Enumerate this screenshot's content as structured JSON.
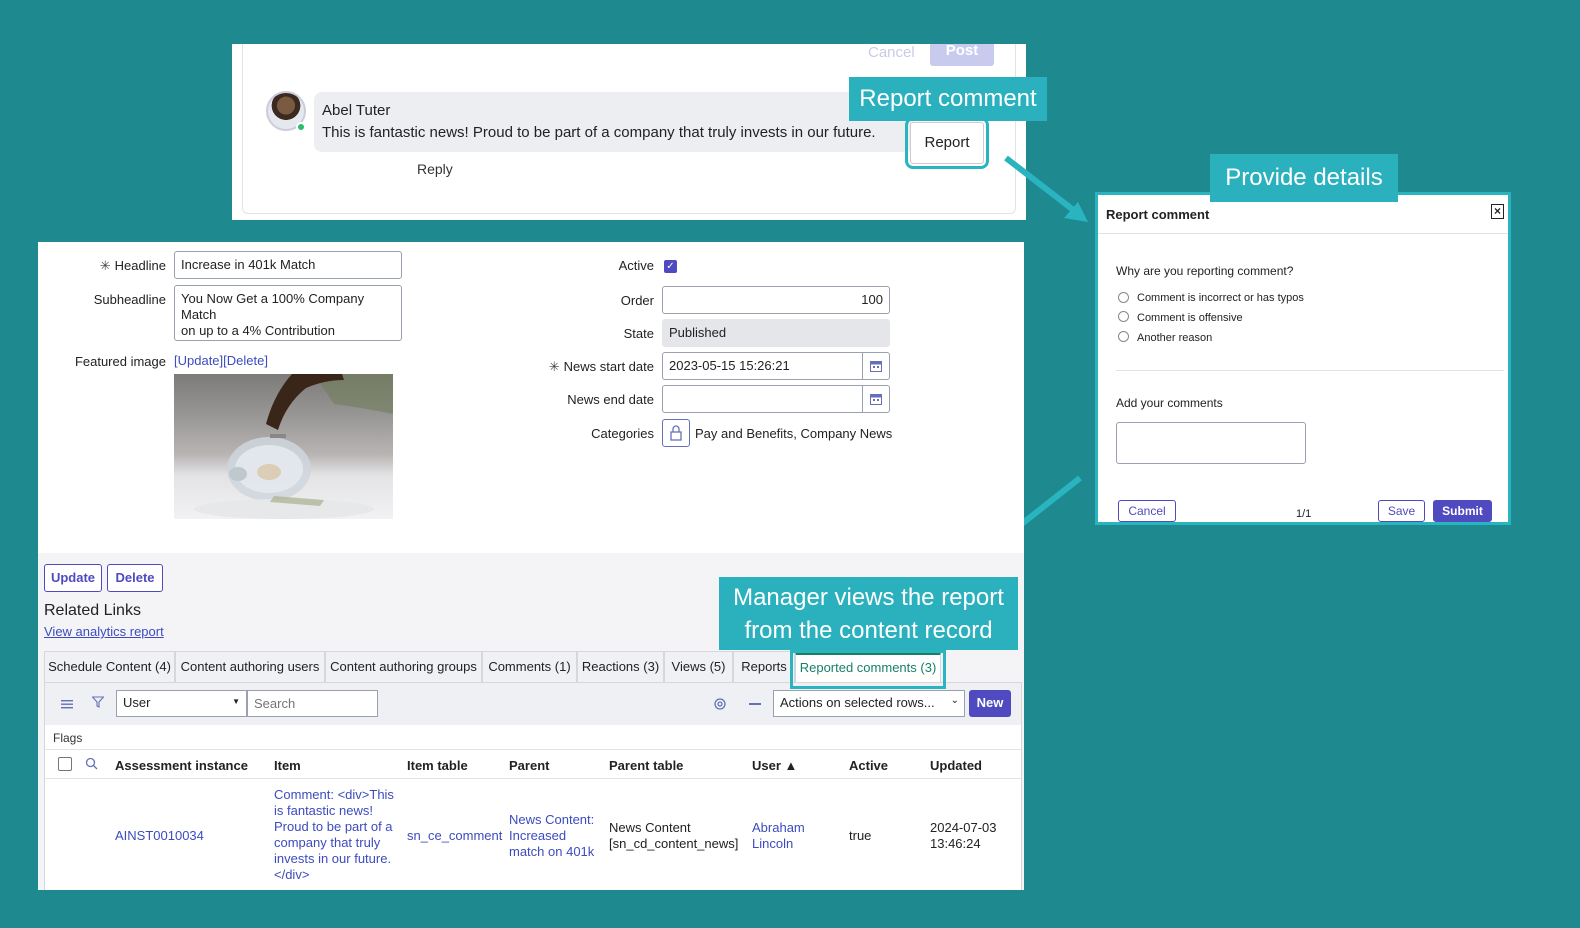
{
  "comment_panel": {
    "cancel_label": "Cancel",
    "post_label": "Post",
    "author": "Abel Tuter",
    "text": "This is fantastic news! Proud to be part of a company that truly invests in our future.",
    "reply_label": "Reply",
    "report_label": "Report"
  },
  "callouts": {
    "report_comment": "Report comment",
    "provide_details": "Provide details",
    "manager_line1": "Manager views the report",
    "manager_line2": "from the content record"
  },
  "form": {
    "headline_label": "Headline",
    "headline_value": "Increase in 401k Match",
    "subheadline_label": "Subheadline",
    "subheadline_line1": "You Now Get a 100% Company Match",
    "subheadline_line2": "on up to a 4% Contribution",
    "featured_image_label": "Featured image",
    "update_link": "[Update]",
    "delete_link": "[Delete]",
    "active_label": "Active",
    "order_label": "Order",
    "order_value": "100",
    "state_label": "State",
    "state_value": "Published",
    "news_start_label": "News start date",
    "news_start_value": "2023-05-15 15:26:21",
    "news_end_label": "News end date",
    "news_end_value": "",
    "categories_label": "Categories",
    "categories_value": "Pay and Benefits, Company News",
    "update_button": "Update",
    "delete_button": "Delete",
    "related_links": "Related Links",
    "analytics_link": "View analytics report"
  },
  "tabs": [
    {
      "label": "Schedule Content (4)"
    },
    {
      "label": "Content authoring users"
    },
    {
      "label": "Content authoring groups"
    },
    {
      "label": "Comments (1)"
    },
    {
      "label": "Reactions (3)"
    },
    {
      "label": "Views (5)"
    },
    {
      "label": "Reports"
    },
    {
      "label": "Reported comments (3)"
    }
  ],
  "list": {
    "filter_field": "User",
    "search_placeholder": "Search",
    "actions_label": "Actions on selected rows...",
    "new_label": "New",
    "flags_label": "Flags",
    "columns": [
      "Assessment instance",
      "Item",
      "Item table",
      "Parent",
      "Parent table",
      "User ▲",
      "Active",
      "Updated"
    ],
    "row": {
      "assessment": "AINST0010034",
      "item_lines": [
        "Comment: <div>This",
        "is fantastic news!",
        "Proud to be part of a",
        "company that truly",
        "invests in our future.",
        "</div>"
      ],
      "item_table": "sn_ce_comment",
      "parent_lines": [
        "News Content:",
        "Increased",
        "match on 401k"
      ],
      "parent_table_lines": [
        "News Content",
        "[sn_cd_content_news]"
      ],
      "user_lines": [
        "Abraham",
        "Lincoln"
      ],
      "active": "true",
      "updated_lines": [
        "2024-07-03",
        "13:46:24"
      ]
    }
  },
  "dialog": {
    "title": "Report comment",
    "close_label": "×",
    "question": "Why are you reporting comment?",
    "options": [
      "Comment is incorrect or has typos",
      "Comment is offensive",
      "Another reason"
    ],
    "comments_label": "Add your comments",
    "cancel_label": "Cancel",
    "pager": "1/1",
    "save_label": "Save",
    "submit_label": "Submit"
  },
  "colors": {
    "background": "#1e8a90",
    "callout": "#2bb1bd",
    "accent": "#4f4ac0",
    "active_tab": "#1a7f65"
  }
}
